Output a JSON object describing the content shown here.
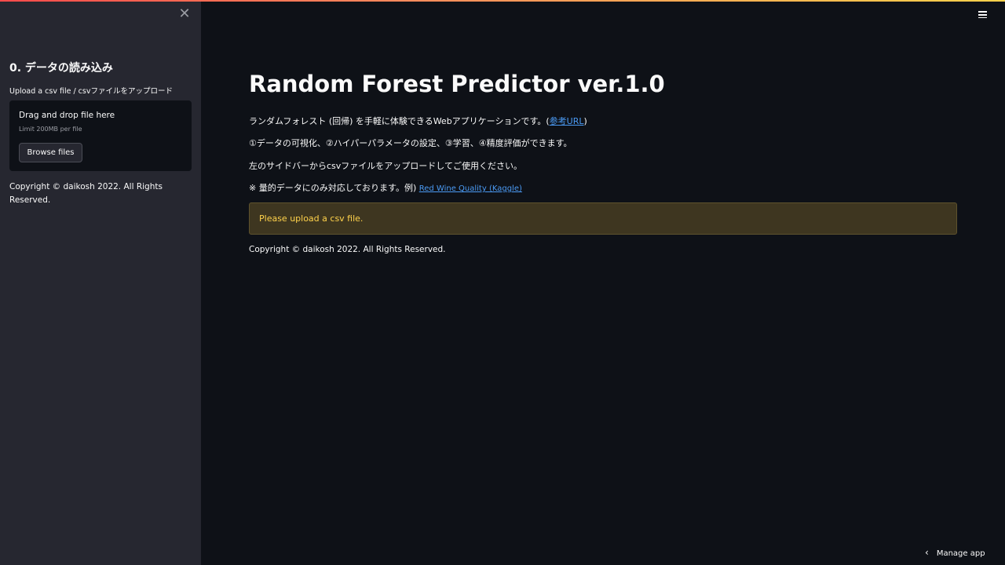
{
  "sidebar": {
    "close_icon": "close-icon",
    "header": "0. データの読み込み",
    "upload_label": "Upload a csv file / csvファイルをアップロード",
    "dropzone": {
      "title": "Drag and drop file here",
      "limit": "Limit 200MB per file",
      "browse_label": "Browse files"
    },
    "copyright": "Copyright © daikosh 2022. All Rights Reserved."
  },
  "main": {
    "title": "Random Forest Predictor ver.1.0",
    "para1_prefix": "ランダムフォレスト (回帰) を手軽に体験できるWebアプリケーションです。(",
    "para1_link": "参考URL",
    "para1_suffix": ")",
    "para2": "①データの可視化、②ハイパーパラメータの設定、③学習、④精度評価ができます。",
    "para3": "左のサイドバーからcsvファイルをアップロードしてご使用ください。",
    "para4_prefix": "※ 量的データにのみ対応しております。例) ",
    "para4_link": "Red Wine Quality (Kaggle)",
    "warning": "Please upload a csv file.",
    "copyright": "Copyright © daikosh 2022. All Rights Reserved."
  },
  "header": {
    "menu_icon": "hamburger-menu-icon"
  },
  "footer": {
    "manage_app": "Manage app",
    "chevron_icon": "chevron-left-icon"
  },
  "colors": {
    "background": "#0e1117",
    "sidebar": "#262730",
    "link": "#4b9bf5",
    "warning_text": "#ffd24b",
    "warning_bg": "#3e3620"
  }
}
